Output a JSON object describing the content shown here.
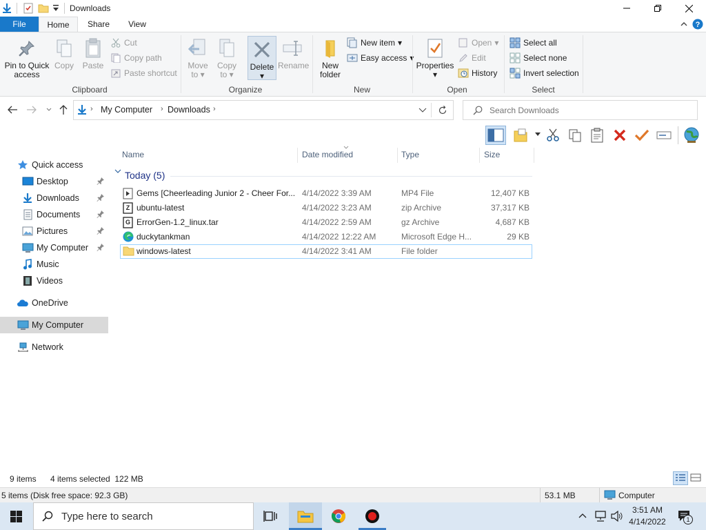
{
  "window": {
    "title": "Downloads",
    "minimize_icon": "minimize-icon",
    "maximize_icon": "restore-icon",
    "close_icon": "close-icon"
  },
  "ribbon_tabs": [
    "File",
    "Home",
    "Share",
    "View"
  ],
  "ribbon": {
    "clipboard": {
      "label": "Clipboard",
      "pin": "Pin to Quick",
      "pin2": "access",
      "copy": "Copy",
      "paste": "Paste",
      "cut": "Cut",
      "copy_path": "Copy path",
      "paste_shortcut": "Paste shortcut"
    },
    "organize": {
      "label": "Organize",
      "move": "Move",
      "move2": "to",
      "copy": "Copy",
      "copy2": "to",
      "delete": "Delete",
      "rename": "Rename"
    },
    "new": {
      "label": "New",
      "new_folder": "New",
      "new_folder2": "folder",
      "new_item": "New item",
      "easy_access": "Easy access"
    },
    "open": {
      "label": "Open",
      "properties": "Properties",
      "open": "Open",
      "edit": "Edit",
      "history": "History"
    },
    "select": {
      "label": "Select",
      "select_all": "Select all",
      "select_none": "Select none",
      "invert": "Invert selection"
    }
  },
  "address": {
    "crumbs": [
      "My Computer",
      "Downloads"
    ],
    "search_placeholder": "Search Downloads"
  },
  "nav": {
    "quick_access": "Quick access",
    "items": [
      "Desktop",
      "Downloads",
      "Documents",
      "Pictures",
      "My Computer",
      "Music",
      "Videos"
    ],
    "onedrive": "OneDrive",
    "mycomputer": "My Computer",
    "network": "Network"
  },
  "columns": [
    "Name",
    "Date modified",
    "Type",
    "Size"
  ],
  "group": "Today (5)",
  "files": [
    {
      "name": "Gems  [Cheerleading Junior 2 - Cheer For...",
      "date": "4/14/2022 3:39 AM",
      "type": "MP4 File",
      "size": "12,407 KB",
      "icon": "video-file-icon"
    },
    {
      "name": "ubuntu-latest",
      "date": "4/14/2022 3:23 AM",
      "type": "zip Archive",
      "size": "37,317 KB",
      "icon": "zip-archive-icon"
    },
    {
      "name": "ErrorGen-1.2_linux.tar",
      "date": "4/14/2022 2:59 AM",
      "type": "gz Archive",
      "size": "4,687 KB",
      "icon": "gz-archive-icon"
    },
    {
      "name": "duckytankman",
      "date": "4/14/2022 12:22 AM",
      "type": "Microsoft Edge H...",
      "size": "29 KB",
      "icon": "edge-html-icon"
    },
    {
      "name": "windows-latest",
      "date": "4/14/2022 3:41 AM",
      "type": "File folder",
      "size": "",
      "icon": "folder-icon"
    }
  ],
  "status": {
    "items": "9 items",
    "selected": "4 items selected  122 MB",
    "disk": "5 items (Disk free space: 92.3 GB)",
    "size": "53.1 MB",
    "computer": "Computer"
  },
  "taskbar": {
    "search_placeholder": "Type here to search",
    "time": "3:51 AM",
    "date": "4/14/2022",
    "notifications": "1"
  }
}
